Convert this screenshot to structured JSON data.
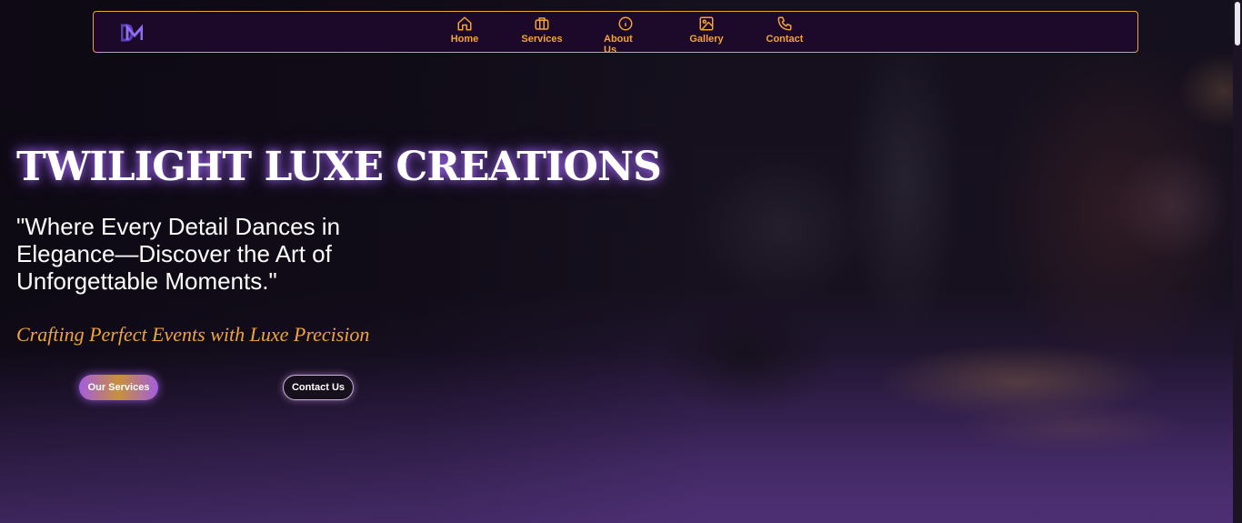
{
  "nav": {
    "logo_text": "DM",
    "items": [
      {
        "label": "Home",
        "icon": "home-icon"
      },
      {
        "label": "Services",
        "icon": "briefcase-icon"
      },
      {
        "label": "About Us",
        "icon": "info-icon"
      },
      {
        "label": "Gallery",
        "icon": "image-icon"
      },
      {
        "label": "Contact",
        "icon": "phone-icon"
      }
    ]
  },
  "hero": {
    "title": "TWILIGHT LUXE CREATIONS",
    "quote": "\"Where Every Detail Dances in Elegance—Discover the Art of Unforgettable Moments.\"",
    "tagline": "Crafting Perfect Events with Luxe Precision",
    "services_button": "Our Services",
    "contact_button": "Contact Us"
  },
  "colors": {
    "accent": "#f0a43a",
    "glow": "#a35de0",
    "background": "#120c1c"
  }
}
